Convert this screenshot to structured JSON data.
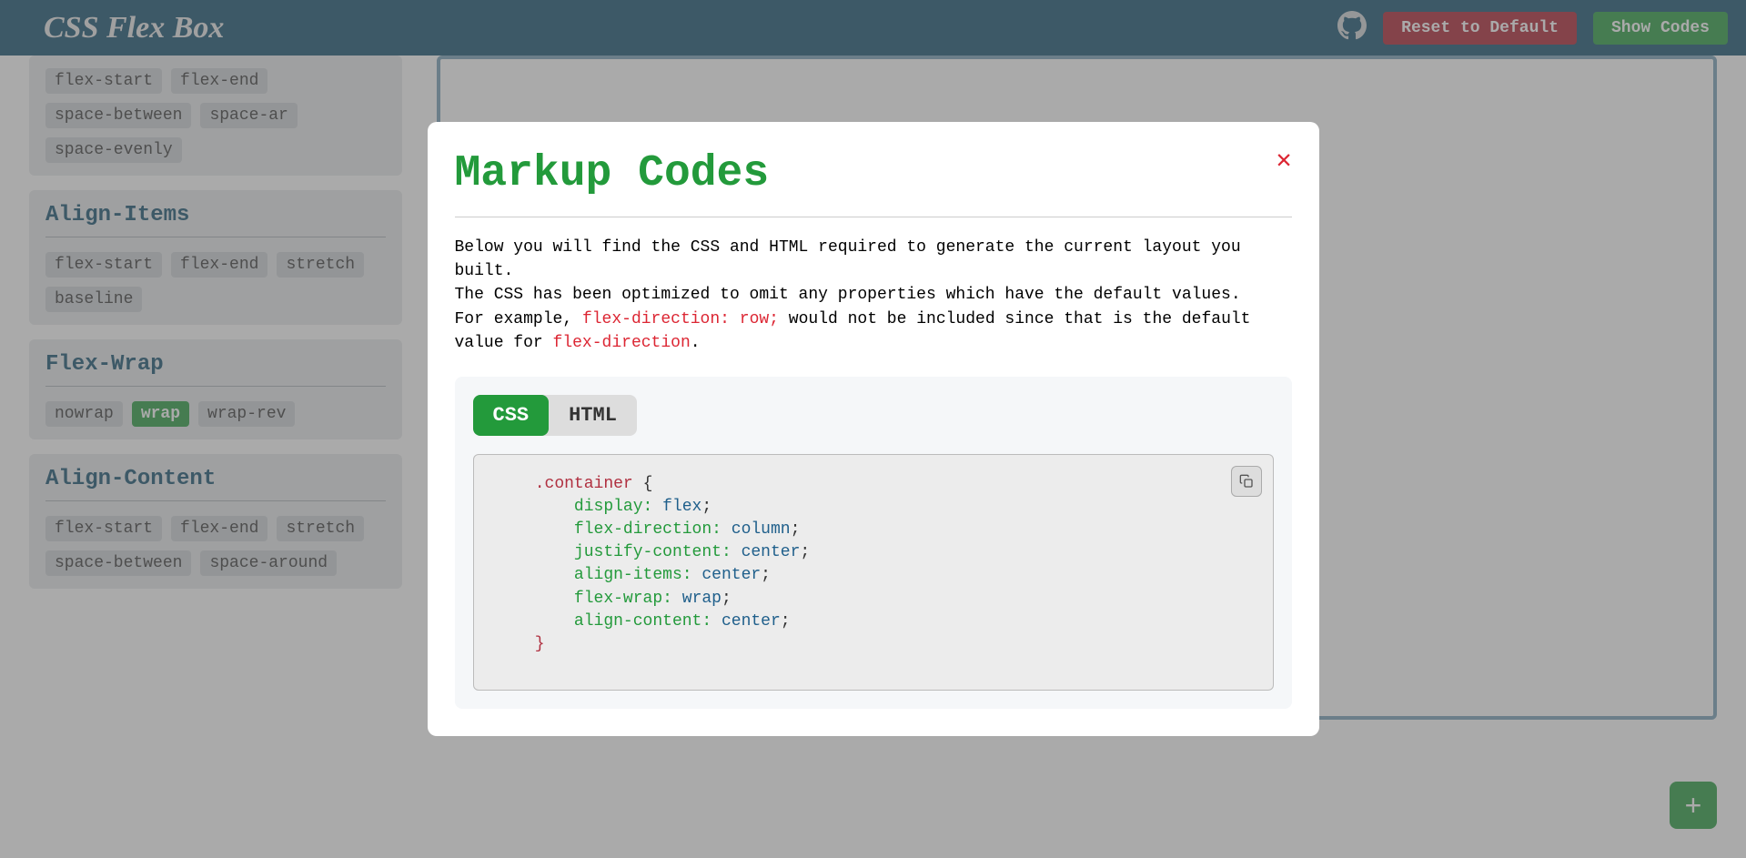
{
  "header": {
    "logo": "CSS Flex Box",
    "reset_label": "Reset to Default",
    "show_codes_label": "Show Codes"
  },
  "sidebar": {
    "justify_content": {
      "items": [
        "flex-start",
        "flex-end",
        "space-between",
        "space-ar",
        "space-evenly"
      ]
    },
    "align_items": {
      "title": "Align-Items",
      "items": [
        "flex-start",
        "flex-end",
        "stretch",
        "baseline"
      ]
    },
    "flex_wrap": {
      "title": "Flex-Wrap",
      "items": [
        "nowrap",
        "wrap",
        "wrap-rev"
      ],
      "active": "wrap"
    },
    "align_content": {
      "title": "Align-Content",
      "items": [
        "flex-start",
        "flex-end",
        "stretch",
        "space-between",
        "space-around"
      ]
    }
  },
  "modal": {
    "title": "Markup Codes",
    "desc_line1": "Below you will find the CSS and HTML required to generate the current layout you built.",
    "desc_line2a": "The CSS has been optimized to omit any properties which have the default values.",
    "desc_line3a": "For example, ",
    "desc_line3_code": "flex-direction: row;",
    "desc_line3b": " would not be included since that is the default value for ",
    "desc_line3_code2": "flex-direction",
    "desc_line3c": ".",
    "tab_css": "CSS",
    "tab_html": "HTML",
    "code": {
      "selector": ".container",
      "props": [
        {
          "p": "display",
          "v": "flex"
        },
        {
          "p": "flex-direction",
          "v": "column"
        },
        {
          "p": "justify-content",
          "v": "center"
        },
        {
          "p": "align-items",
          "v": "center"
        },
        {
          "p": "flex-wrap",
          "v": "wrap"
        },
        {
          "p": "align-content",
          "v": "center"
        }
      ]
    }
  },
  "fab": "+"
}
